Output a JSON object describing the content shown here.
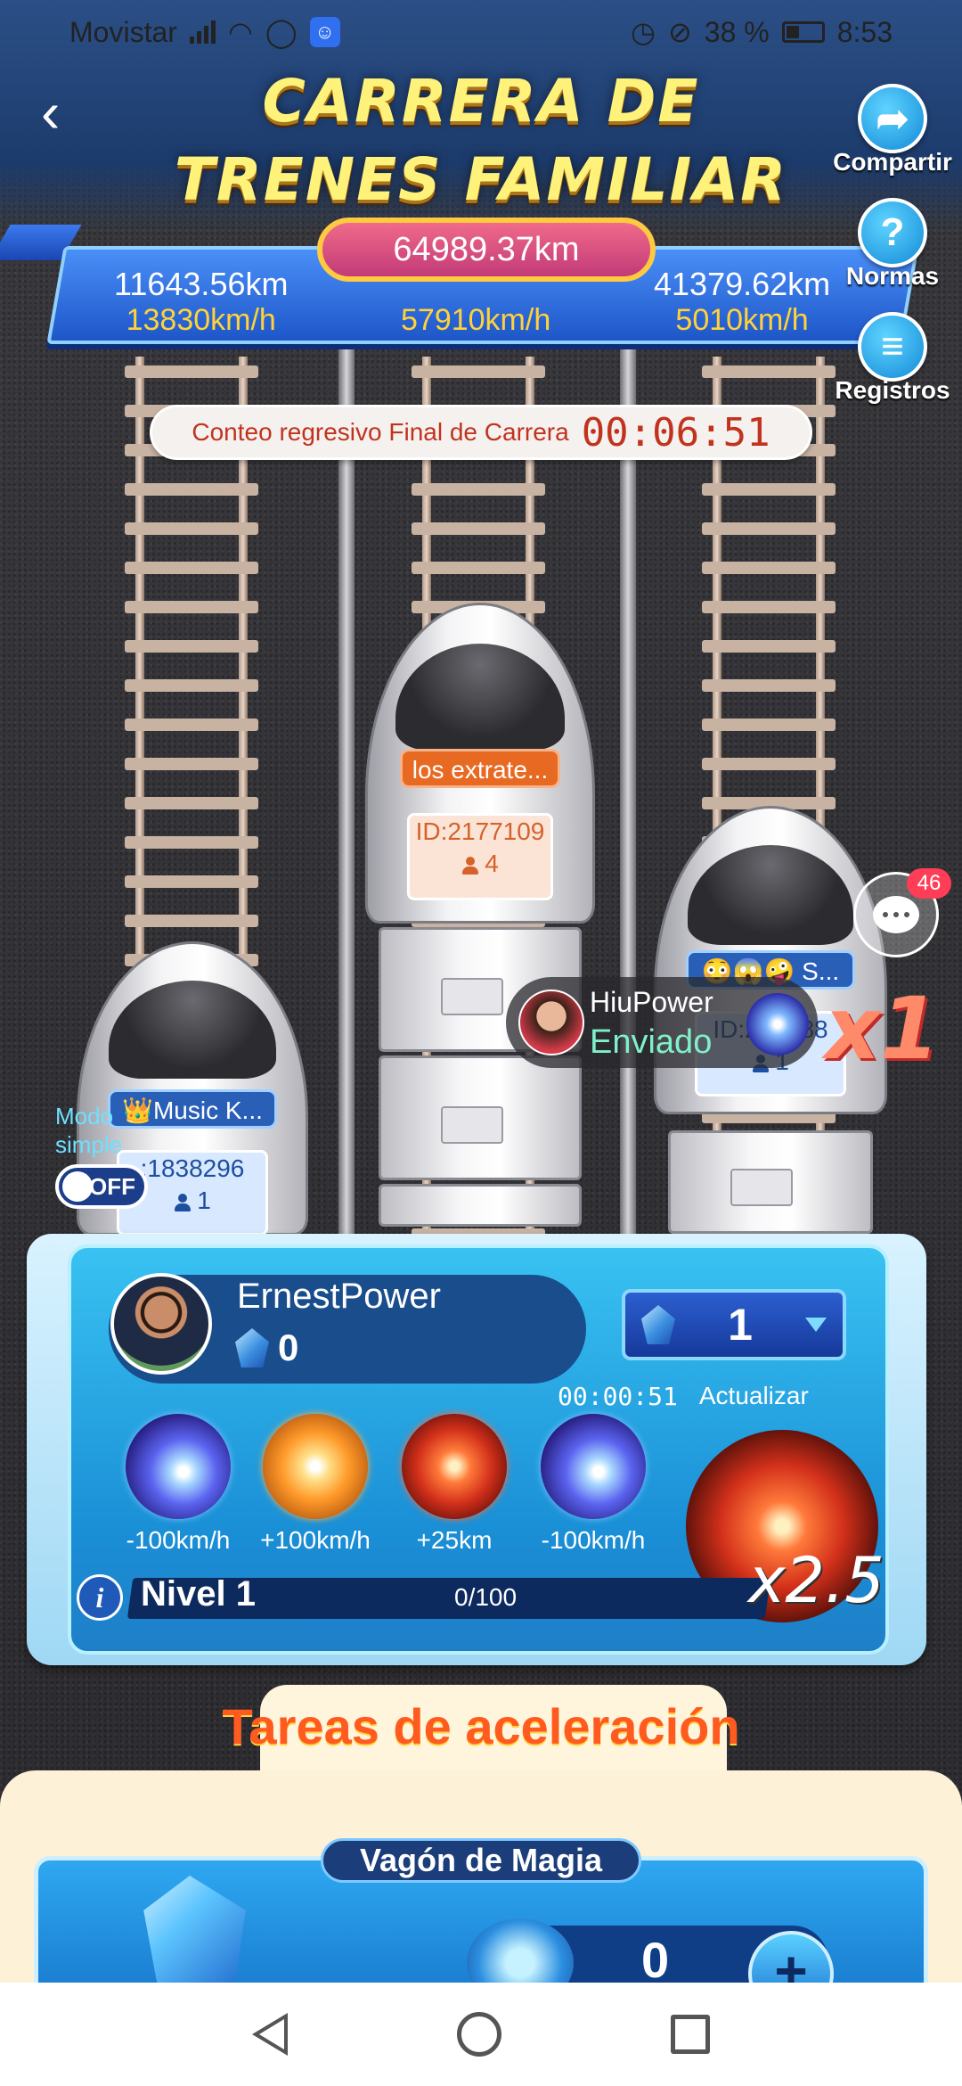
{
  "status_bar": {
    "carrier": "Movistar",
    "battery": "38 %",
    "time": "8:53",
    "icons": [
      "signal-icon",
      "wifi-icon",
      "whatsapp-icon",
      "app-notification-icon",
      "alarm-icon",
      "mute-icon",
      "battery-icon"
    ]
  },
  "header": {
    "title_line1": "CARRERA DE",
    "title_line2": "TRENES FAMILIAR"
  },
  "side_buttons": {
    "share": "Compartir",
    "rules": "Normas",
    "records": "Registros"
  },
  "scoreboard": {
    "total_distance": "64989.37km",
    "left": {
      "distance": "11643.56km",
      "speed": "13830km/h"
    },
    "center": {
      "speed": "57910km/h"
    },
    "right": {
      "distance": "41379.62km",
      "speed": "5010km/h"
    }
  },
  "countdown": {
    "label": "Conteo regresivo Final de Carrera",
    "time": "00:06:51"
  },
  "trains": {
    "left": {
      "name": "👑Music K...",
      "id": ":1838296",
      "members": "1"
    },
    "center": {
      "name": "los extrate...",
      "id": "ID:2177109",
      "members": "4"
    },
    "right": {
      "name": "😳😱🤪 S...",
      "id": "ID:21?288",
      "members": "1"
    }
  },
  "simple_mode": {
    "label": "Modo simple",
    "toggle": "OFF"
  },
  "chat": {
    "badge": "46"
  },
  "gift_notification": {
    "user": "HiuPower",
    "status": "Enviado",
    "multiplier": "x1"
  },
  "panel": {
    "user_name": "ErnestPower",
    "user_gems": "0",
    "gem_selector_value": "1",
    "timer": "00:00:51",
    "update_label": "Actualizar",
    "skills": [
      {
        "label": "-100km/h",
        "icon": "blue-burst-icon"
      },
      {
        "label": "+100km/h",
        "icon": "gold-burst-icon"
      },
      {
        "label": "+25km",
        "icon": "fire-tornado-icon"
      },
      {
        "label": "-100km/h",
        "icon": "blue-burst-icon"
      }
    ],
    "featured_multiplier": "x2.5",
    "level_label": "Nivel 1",
    "level_progress": "0/100"
  },
  "tasks": {
    "title": "Tareas de aceleración",
    "magic_wagon_title": "Vagón de Magia",
    "magic_count": "0"
  },
  "colors": {
    "title_yellow": "#fff27a",
    "countdown_red": "#c2331e",
    "panel_blue": "#1a8fd6",
    "task_orange": "#ff5a1f"
  }
}
